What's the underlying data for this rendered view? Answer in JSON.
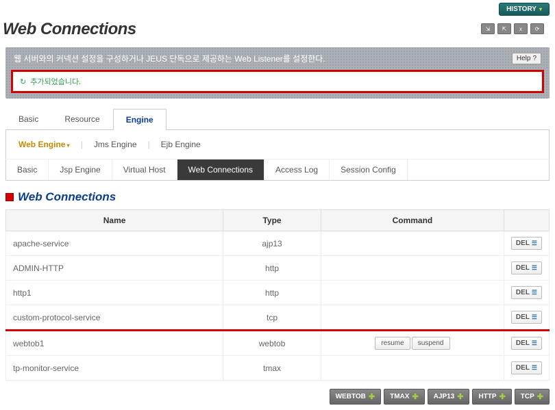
{
  "header": {
    "title": "Web Connections",
    "history_label": "HISTORY"
  },
  "banner": {
    "text": "웹 서버와의 커넥션 설정을 구성하거나 JEUS 단독으로 제공하는 Web Listener를 설정한다.",
    "help_label": "Help",
    "notification": "추가되었습니다."
  },
  "tabs_level1": [
    {
      "label": "Basic",
      "active": false
    },
    {
      "label": "Resource",
      "active": false
    },
    {
      "label": "Engine",
      "active": true
    }
  ],
  "tabs_level2": [
    {
      "label": "Web Engine",
      "active": true
    },
    {
      "label": "Jms Engine",
      "active": false
    },
    {
      "label": "Ejb Engine",
      "active": false
    }
  ],
  "tabs_level3": [
    {
      "label": "Basic",
      "active": false
    },
    {
      "label": "Jsp Engine",
      "active": false
    },
    {
      "label": "Virtual Host",
      "active": false
    },
    {
      "label": "Web Connections",
      "active": true
    },
    {
      "label": "Access Log",
      "active": false
    },
    {
      "label": "Session Config",
      "active": false
    }
  ],
  "section": {
    "title": "Web Connections"
  },
  "table": {
    "headers": {
      "name": "Name",
      "type": "Type",
      "command": "Command"
    },
    "del_label": "DEL",
    "cmd_resume": "resume",
    "cmd_suspend": "suspend",
    "rows": [
      {
        "name": "apache-service",
        "type": "ajp13",
        "commands": [],
        "highlight": false
      },
      {
        "name": "ADMIN-HTTP",
        "type": "http",
        "commands": [],
        "highlight": false
      },
      {
        "name": "http1",
        "type": "http",
        "commands": [],
        "highlight": false
      },
      {
        "name": "custom-protocol-service",
        "type": "tcp",
        "commands": [],
        "highlight": true
      },
      {
        "name": "webtob1",
        "type": "webtob",
        "commands": [
          "resume",
          "suspend"
        ],
        "highlight": false
      },
      {
        "name": "tp-monitor-service",
        "type": "tmax",
        "commands": [],
        "highlight": false
      }
    ]
  },
  "footer_buttons": [
    {
      "label": "WEBTOB"
    },
    {
      "label": "TMAX"
    },
    {
      "label": "AJP13"
    },
    {
      "label": "HTTP"
    },
    {
      "label": "TCP"
    }
  ]
}
